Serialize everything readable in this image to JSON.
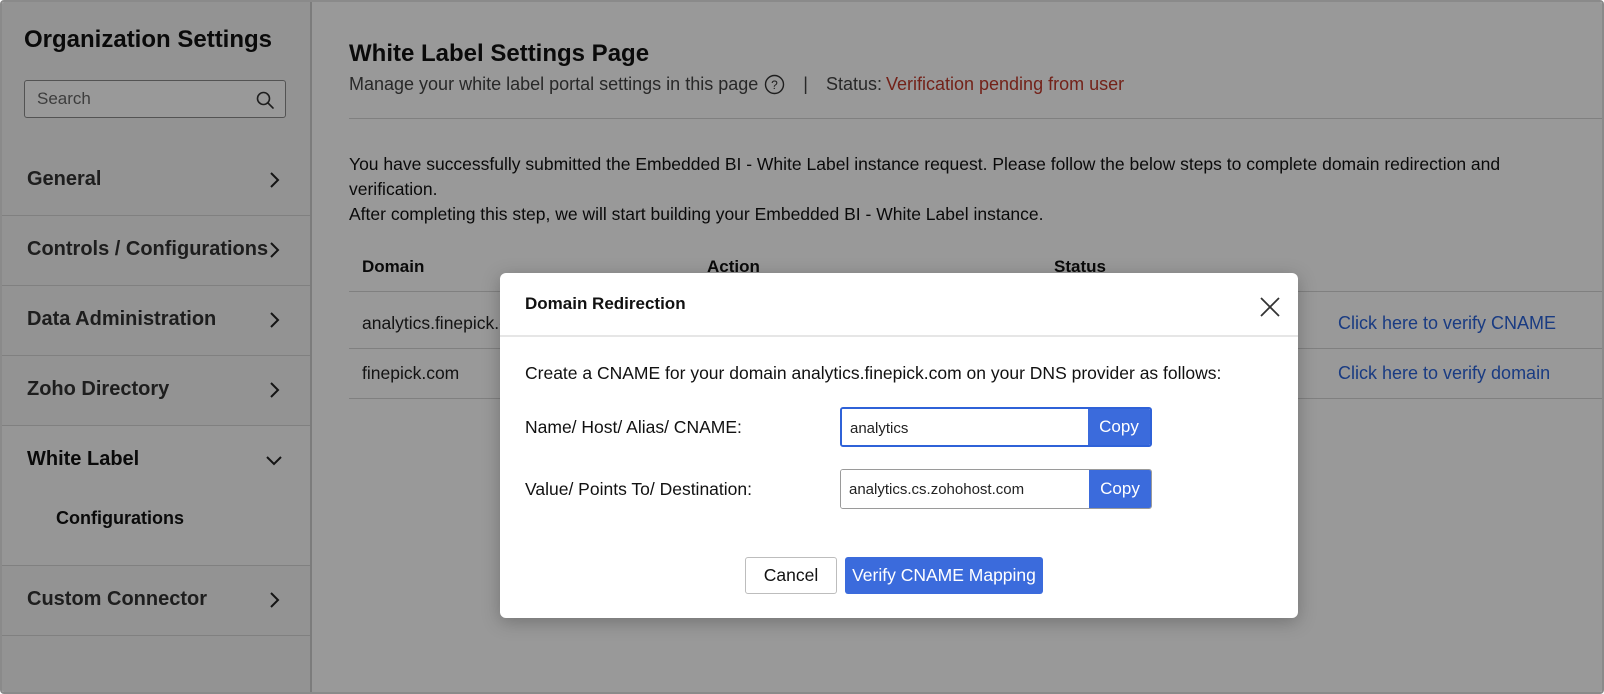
{
  "sidebar": {
    "title": "Organization Settings",
    "search_placeholder": "Search",
    "items": [
      {
        "label": "General"
      },
      {
        "label": "Controls / Configurations"
      },
      {
        "label": "Data Administration"
      },
      {
        "label": "Zoho Directory"
      },
      {
        "label": "White Label",
        "expanded": true,
        "children": [
          {
            "label": "Configurations"
          }
        ]
      },
      {
        "label": "Custom Connector"
      }
    ]
  },
  "main": {
    "title": "White Label Settings Page",
    "subtitle": "Manage your white label portal settings in this page",
    "separator": "|",
    "status_label": "Status:",
    "status_value": "Verification pending from user",
    "description_line1": "You have successfully submitted the Embedded BI - White Label instance request. Please follow the below steps to complete domain redirection and verification.",
    "description_line2": "After completing this step, we will start building your Embedded BI - White Label instance.",
    "table": {
      "headers": [
        "Domain",
        "Action",
        "Status"
      ],
      "rows": [
        {
          "domain": "analytics.finepick.com",
          "action": "Click here to verify CNAME"
        },
        {
          "domain": "finepick.com",
          "action": "Click here to verify domain"
        }
      ]
    }
  },
  "modal": {
    "title": "Domain Redirection",
    "description": "Create a CNAME for your domain analytics.finepick.com on your DNS provider as follows:",
    "fields": [
      {
        "label": "Name/ Host/ Alias/ CNAME:",
        "value": "analytics",
        "copy_label": "Copy"
      },
      {
        "label": "Value/ Points To/ Destination:",
        "value": "analytics.cs.zohohost.com",
        "copy_label": "Copy"
      }
    ],
    "cancel_label": "Cancel",
    "verify_label": "Verify CNAME Mapping"
  },
  "colors": {
    "accent": "#3b6bdc",
    "link": "#2b63d9",
    "status_pending": "#c0392b"
  }
}
